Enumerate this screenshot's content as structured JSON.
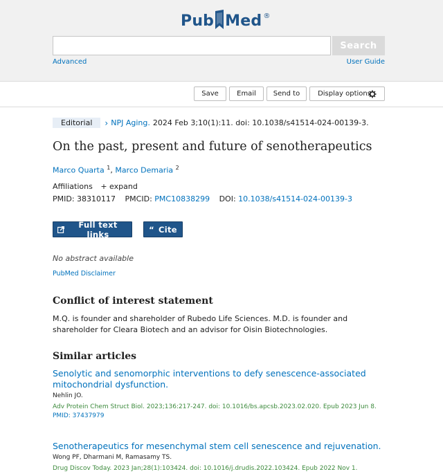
{
  "header": {
    "logo_text_left": "Pub",
    "logo_text_right": "Med",
    "logo_reg": "®",
    "search_placeholder": "",
    "search_value": "",
    "search_button": "Search",
    "advanced_link": "Advanced",
    "user_guide_link": "User Guide"
  },
  "actions": {
    "save": "Save",
    "email": "Email",
    "send_to": "Send to",
    "display_options": "Display options"
  },
  "article": {
    "type_badge": "Editorial",
    "journal": "NPJ Aging.",
    "citation": "2024 Feb 3;10(1):11. doi: 10.1038/s41514-024-00139-3.",
    "title": "On the past, present and future of senotherapeutics",
    "authors": [
      {
        "name": "Marco Quarta",
        "sup": "1"
      },
      {
        "name": "Marco Demaria",
        "sup": "2"
      }
    ],
    "affiliations_label": "Affiliations",
    "expand_label": "+ expand",
    "pmid_label": "PMID:",
    "pmid": "38310117",
    "pmcid_label": "PMCID:",
    "pmcid": "PMC10838299",
    "doi_label": "DOI:",
    "doi": "10.1038/s41514-024-00139-3",
    "full_text_button": "Full text links",
    "cite_button": "Cite",
    "no_abstract": "No abstract available",
    "disclaimer": "PubMed Disclaimer"
  },
  "coi": {
    "heading": "Conflict of interest statement",
    "text": "M.Q. is founder and shareholder of Rubedo Life Sciences. M.D. is founder and shareholder for Cleara Biotech and an advisor for Oisin Biotechnologies."
  },
  "similar": {
    "heading": "Similar articles",
    "items": [
      {
        "title": "Senolytic and senomorphic interventions to defy senescence-associated mitochondrial dysfunction.",
        "authors": "Nehlin JO.",
        "citation": "Adv Protein Chem Struct Biol. 2023;136:217-247. doi: 10.1016/bs.apcsb.2023.02.020. Epub 2023 Jun 8.",
        "pmid": "PMID: 37437979"
      },
      {
        "title": "Senotherapeutics for mesenchymal stem cell senescence and rejuvenation.",
        "authors": "Wong PF, Dharmani M, Ramasamy TS.",
        "citation": "Drug Discov Today. 2023 Jan;28(1):103424. doi: 10.1016/j.drudis.2022.103424. Epub 2022 Nov 1.",
        "pmid": ""
      }
    ]
  },
  "colors": {
    "brand": "#20558a",
    "link": "#0071bc",
    "citation_green": "#3c8a3c",
    "header_bg": "#f1f1f1"
  }
}
